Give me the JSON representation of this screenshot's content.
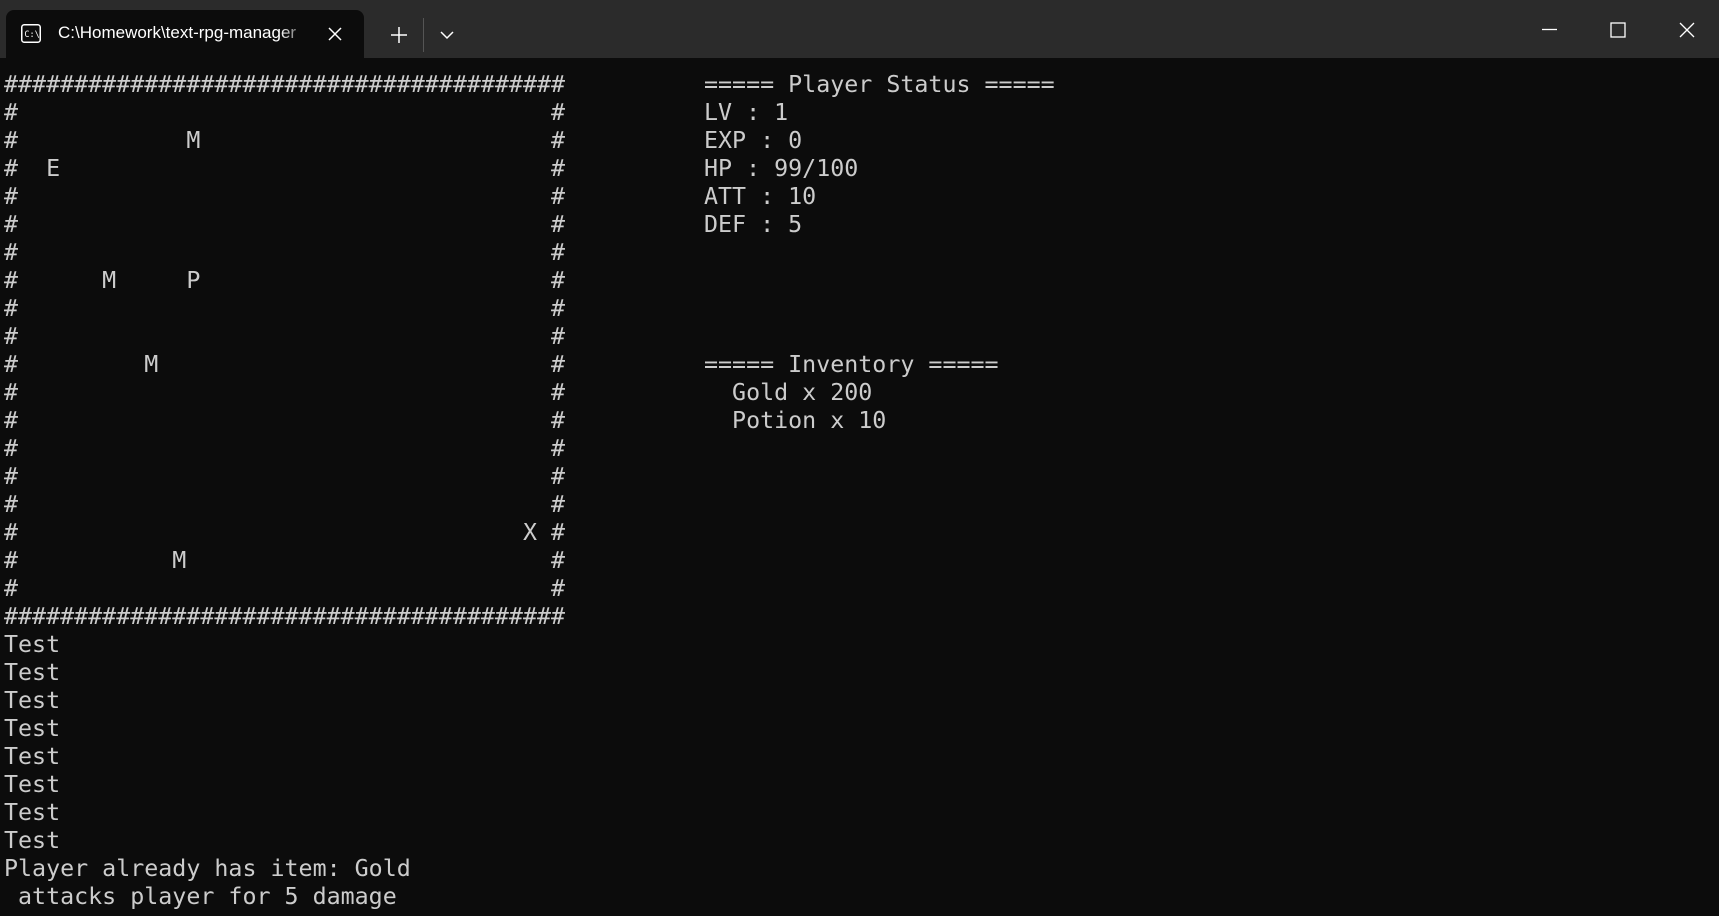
{
  "window": {
    "tab_title": "C:\\Homework\\text-rpg-manager",
    "tab_icon": "terminal-icon",
    "close_tab_icon": "close-icon",
    "new_tab_icon": "plus-icon",
    "dropdown_icon": "chevron-down-icon",
    "minimize_icon": "minimize-icon",
    "maximize_icon": "maximize-icon",
    "close_window_icon": "close-icon"
  },
  "map": {
    "rows": [
      "########################################",
      "#                                      #",
      "#            M                         #",
      "#  E                                   #",
      "#                                      #",
      "#                                      #",
      "#                                      #",
      "#      M     P                         #",
      "#                                      #",
      "#                                      #",
      "#         M                            #",
      "#                                      #",
      "#                                      #",
      "#                                      #",
      "#                                      #",
      "#                                      #",
      "#                                    X #",
      "#           M                          #",
      "#                                      #",
      "########################################"
    ]
  },
  "status": {
    "header": "===== Player Status =====",
    "lv": "LV : 1",
    "exp": "EXP : 0",
    "hp": "HP : 99/100",
    "att": "ATT : 10",
    "def": "DEF : 5"
  },
  "inventory": {
    "header": "===== Inventory =====",
    "items": [
      "  Gold x 200",
      "  Potion x 10"
    ]
  },
  "log": [
    "Test",
    "Test",
    "Test",
    "Test",
    "Test",
    "Test",
    "Test",
    "Test",
    "Player already has item: Gold",
    " attacks player for 5 damage"
  ],
  "colors": {
    "terminal_bg": "#0c0c0c",
    "terminal_fg": "#cccccc",
    "titlebar_bg": "#2b2b2b",
    "tab_fg": "#ffffff"
  }
}
